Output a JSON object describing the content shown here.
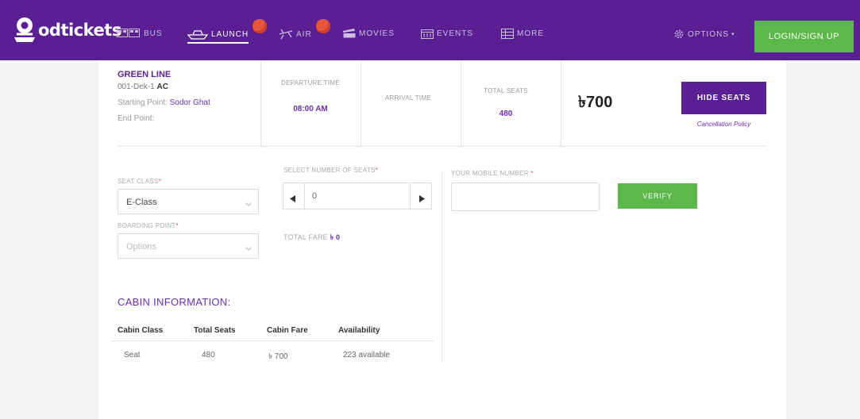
{
  "brand": {
    "logo_text": "odtickets",
    "logo_icon": "bd-logo-icon"
  },
  "nav": {
    "items": [
      {
        "label": "BUS",
        "icon": "bus-icon"
      },
      {
        "label": "LAUNCH",
        "icon": "ship-icon",
        "active": true,
        "badge": true
      },
      {
        "label": "AIR",
        "icon": "plane-icon",
        "badge": true
      },
      {
        "label": "MOVIES",
        "icon": "film-icon"
      },
      {
        "label": "EVENTS",
        "icon": "calendar-icon"
      },
      {
        "label": "MORE",
        "icon": "grid-icon"
      }
    ],
    "options_label": "OPTIONS",
    "login_label": "LOGIN/SIGN UP"
  },
  "trip": {
    "name": "GREEN LINE",
    "code": "001-Dek-1",
    "code_class": "AC",
    "starting_point_label": "Starting Point:",
    "starting_point_value": "Sodor Ghat",
    "end_point_label": "End Point:",
    "departure_label": "DEPARTURE TIME",
    "departure_value": "08:00 AM",
    "arrival_label": "ARRIVAL TIME",
    "total_seats_label": "TOTAL SEATS",
    "total_seats_value": "480",
    "price": "৳700",
    "hide_seats_label": "HIDE SEATS",
    "cancellation_label": "Cancellation Policy"
  },
  "booking": {
    "seat_class_label": "SEAT CLASS",
    "seat_class_value": "E-Class",
    "boarding_label": "BOARDING POINT",
    "boarding_placeholder": "Options",
    "num_seats_label": "SELECT NUMBER OF SEATS",
    "num_seats_value": "0",
    "total_fare_label": "TOTAL FARE",
    "total_fare_value": "৳ 0",
    "mobile_label": "YOUR MOBILE NUMBER",
    "mobile_value": "",
    "verify_label": "VERIFY"
  },
  "cabin": {
    "title": "CABIN INFORMATION:",
    "headers": [
      "Cabin Class",
      "Total Seats",
      "Cabin Fare",
      "Availability"
    ],
    "rows": [
      [
        "Seat",
        "480",
        "৳ 700",
        "223 available"
      ]
    ]
  },
  "colors": {
    "brand_purple": "#5b1f94",
    "accent_purple": "#6a2fb0",
    "green": "#5cb84a",
    "badge": "#e8573a"
  }
}
